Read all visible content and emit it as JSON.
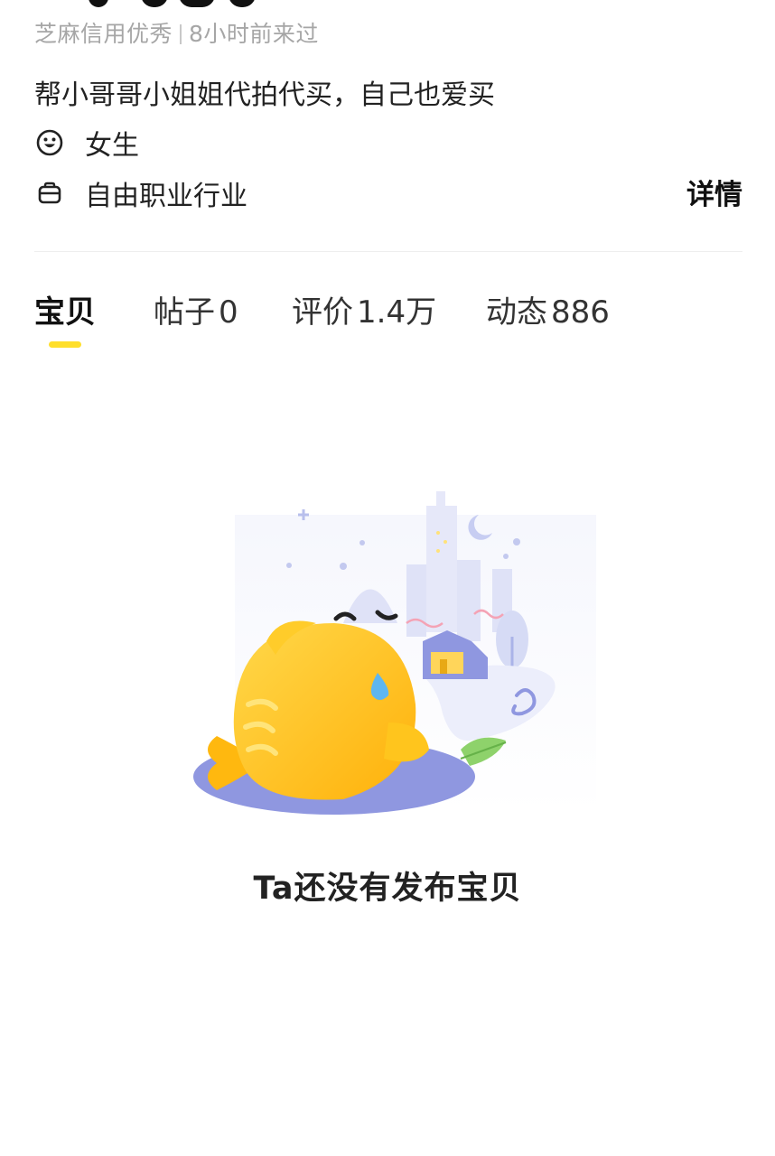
{
  "profile": {
    "credit": "芝麻信用优秀",
    "last_seen": "8小时前来过",
    "bio": "帮小哥哥小姐姐代拍代买，自己也爱买",
    "gender": "女生",
    "occupation": "自由职业行业",
    "details_label": "详情",
    "gender_icon": "smiley-face-icon",
    "occupation_icon": "briefcase-icon"
  },
  "tabs": [
    {
      "label": "宝贝",
      "count": ""
    },
    {
      "label": "帖子",
      "count": "0"
    },
    {
      "label": "评价",
      "count": "1.4万"
    },
    {
      "label": "动态",
      "count": "886"
    }
  ],
  "active_tab_index": 0,
  "empty_state": {
    "message": "Ta还没有发布宝贝",
    "illustration": "sad-yellow-fish-illustration"
  },
  "colors": {
    "accent": "#ffdf2b",
    "fish": "#ffc21a",
    "scene": "#8f97e0"
  }
}
